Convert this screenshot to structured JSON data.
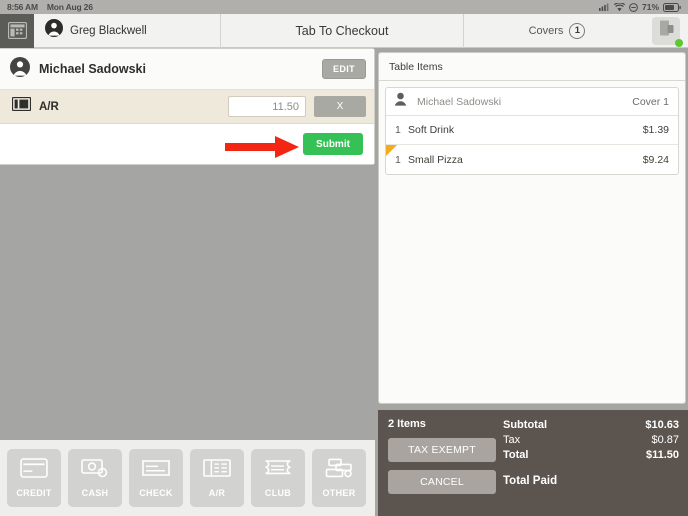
{
  "statusbar": {
    "time": "8:56 AM",
    "date": "Mon Aug 26",
    "battery_pct": "71%",
    "icons": [
      "signal-icon",
      "wifi-icon",
      "do-not-disturb-icon",
      "battery-icon"
    ]
  },
  "navbar": {
    "register_icon": "register-icon",
    "user_icon": "user-avatar-icon",
    "user_name": "Greg Blackwell",
    "title": "Tab To Checkout",
    "covers_label": "Covers",
    "covers_count": "1",
    "printer_icon": "printer-icon",
    "printer_status": "connected"
  },
  "payment_panel": {
    "customer_icon": "user-avatar-icon",
    "customer_name": "Michael Sadowski",
    "edit_label": "EDIT",
    "row": {
      "icon": "ar-ticket-icon",
      "label": "A/R",
      "amount": "11.50",
      "clear_label": "X"
    },
    "submit_label": "Submit",
    "annotation": "red-arrow-pointing-to-submit"
  },
  "items_panel": {
    "header": "Table Items",
    "cover": {
      "icon": "person-icon",
      "name": "Michael Sadowski",
      "label": "Cover 1"
    },
    "items": [
      {
        "qty": "1",
        "name": "Soft Drink",
        "price": "$1.39",
        "flagged": false
      },
      {
        "qty": "1",
        "name": "Small Pizza",
        "price": "$9.24",
        "flagged": true
      }
    ]
  },
  "totals": {
    "item_count": "2 Items",
    "tax_exempt_label": "TAX EXEMPT",
    "cancel_label": "CANCEL",
    "lines": [
      {
        "label": "Subtotal",
        "value": "$10.63",
        "bold": true
      },
      {
        "label": "Tax",
        "value": "$0.87",
        "bold": false
      },
      {
        "label": "Total",
        "value": "$11.50",
        "bold": true
      }
    ],
    "total_paid_label": "Total Paid"
  },
  "paybar": {
    "tiles": [
      {
        "label": "CREDIT",
        "icon": "credit-card-icon"
      },
      {
        "label": "CASH",
        "icon": "cash-icon"
      },
      {
        "label": "CHECK",
        "icon": "check-icon"
      },
      {
        "label": "A/R",
        "icon": "ar-ticket-icon"
      },
      {
        "label": "CLUB",
        "icon": "club-card-icon"
      },
      {
        "label": "OTHER",
        "icon": "other-payment-icon"
      }
    ]
  },
  "colors": {
    "background": "#a5a5a3",
    "panel": "#fbfbf9",
    "row_beige": "#efe9dc",
    "submit_green": "#35c155",
    "footer_dark": "#5c554f",
    "flag_orange": "#f5ab20",
    "arrow_red": "#f22613",
    "status_dot_green": "#5cc832"
  }
}
